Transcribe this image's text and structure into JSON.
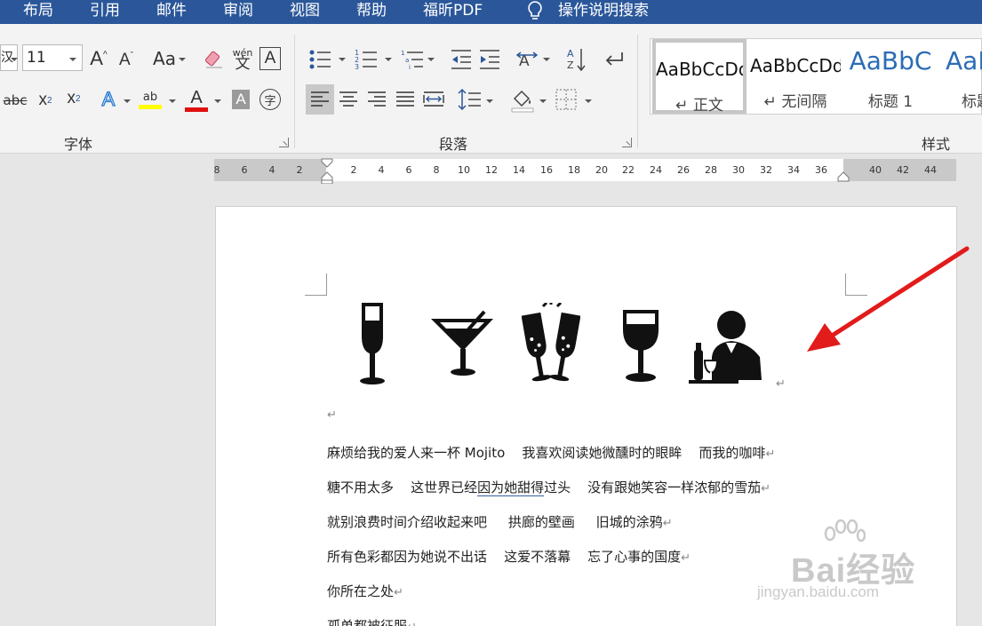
{
  "menu": {
    "tabs": [
      "布局",
      "引用",
      "邮件",
      "审阅",
      "视图",
      "帮助",
      "福昕PDF"
    ],
    "search": "操作说明搜索"
  },
  "ribbon": {
    "font_group_label": "字体",
    "paragraph_group_label": "段落",
    "styles_group_label": "样式",
    "font_name_partial": "汉",
    "font_size": "11",
    "change_case_label": "Aa",
    "phonetic_label": "wén",
    "phonetic_char": "文",
    "char_border_label": "A",
    "strikethrough_label": "abc",
    "subscript_label": "x",
    "superscript_label": "x",
    "text_effect_label": "A",
    "highlight_label": "ab",
    "font_color_label": "A",
    "char_shading_label": "A",
    "enclose_char_label": "字",
    "highlight_color": "#ffff00",
    "font_color": "#e01010",
    "styles": [
      {
        "sample": "AaBbCcDd",
        "label": "↵ 正文",
        "selected": true
      },
      {
        "sample": "AaBbCcDd",
        "label": "↵ 无间隔",
        "selected": false
      },
      {
        "sample": "AaBbC",
        "label": "标题 1",
        "selected": false
      },
      {
        "sample": "AaB",
        "label": "标题",
        "selected": false
      }
    ]
  },
  "ruler": {
    "numbers": [
      "8",
      "6",
      "4",
      "2",
      "2",
      "4",
      "6",
      "8",
      "10",
      "12",
      "14",
      "16",
      "18",
      "20",
      "22",
      "24",
      "26",
      "28",
      "30",
      "32",
      "34",
      "36",
      "40",
      "42",
      "44"
    ]
  },
  "document": {
    "icons": [
      "champagne-flute-icon",
      "cocktail-glass-icon",
      "champagne-toast-icon",
      "wine-glass-icon",
      "waiter-icon"
    ],
    "para_mark": "↵",
    "lines": [
      {
        "pre": "麻烦给我的爱人来一杯 Mojito    我喜欢阅读她微醺时的眼眸    而我的咖啡",
        "ul": "",
        "post": ""
      },
      {
        "pre": "糖不用太多    这世界已经",
        "ul": "因为她甜得",
        "post": "过头    没有跟她笑容一样浓郁的雪茄"
      },
      {
        "pre": "就别浪费时间介绍收起来吧     拱廊的壁画     旧城的涂鸦",
        "ul": "",
        "post": ""
      },
      {
        "pre": "所有色彩都因为她说不出话    这爱不落幕    忘了心事的国度",
        "ul": "",
        "post": ""
      },
      {
        "pre": "你所在之处",
        "ul": "",
        "post": ""
      },
      {
        "pre": "孤单都被征服",
        "ul": "",
        "post": ""
      }
    ]
  },
  "watermark": {
    "text": "Bai经验",
    "sub": "jingyan.baidu.com"
  },
  "colors": {
    "menubar": "#2b579a",
    "arrow": "#e21b1b"
  }
}
